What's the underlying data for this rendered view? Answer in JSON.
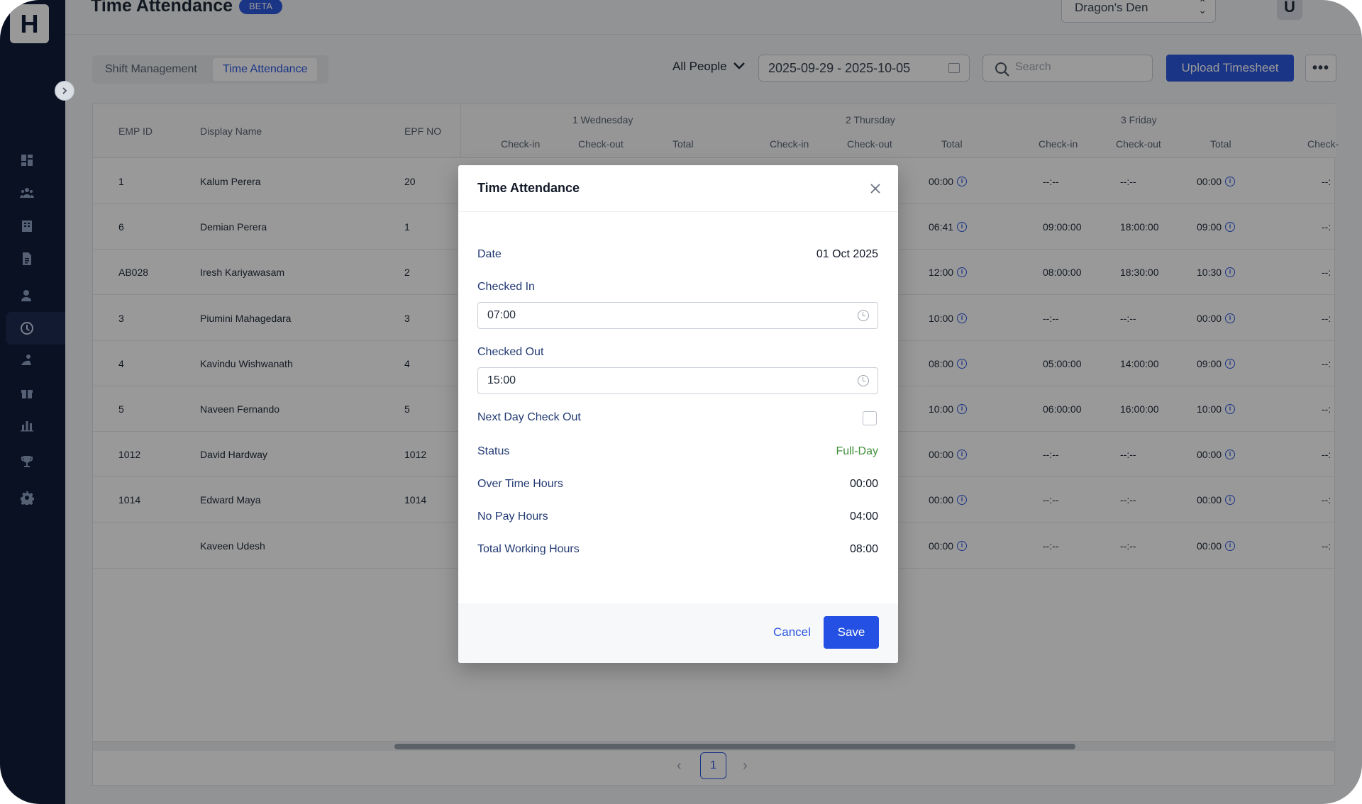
{
  "header": {
    "title": "Time Attendance",
    "badge": "BETA",
    "org": "Dragon's Den",
    "user_initial": "U",
    "logo": "H"
  },
  "toolbar": {
    "tabs": [
      "Shift Management",
      "Time Attendance"
    ],
    "active_tab": "Time Attendance",
    "people_filter": "All People",
    "date_range": "2025-09-29 - 2025-10-05",
    "search_placeholder": "Search",
    "upload_label": "Upload Timesheet"
  },
  "sidebar": {
    "icons": [
      "dashboard-icon",
      "people-icon",
      "building-icon",
      "document-icon",
      "user-icon",
      "clock-icon",
      "leave-icon",
      "gift-icon",
      "reports-icon",
      "trophy-icon",
      "settings-icon"
    ],
    "active": "clock-icon"
  },
  "table": {
    "columns": [
      "EMP ID",
      "Display Name",
      "EPF NO"
    ],
    "days": [
      "1 Wednesday",
      "2 Thursday",
      "3 Friday"
    ],
    "sub_columns": [
      "Check-in",
      "Check-out",
      "Total"
    ],
    "cut_off_column": "Check-",
    "rows": [
      {
        "emp_id": "1",
        "name": "Kalum Perera",
        "epf": "20",
        "day2_total": "00:00",
        "day3_in": "--:--",
        "day3_out": "--:--",
        "day3_total": "00:00",
        "next": "--:"
      },
      {
        "emp_id": "6",
        "name": "Demian Perera",
        "epf": "1",
        "day2_total": "06:41",
        "day3_in": "09:00:00",
        "day3_out": "18:00:00",
        "day3_total": "09:00",
        "next": "--:"
      },
      {
        "emp_id": "AB028",
        "name": "Iresh Kariyawasam",
        "epf": "2",
        "day2_total": "12:00",
        "day3_in": "08:00:00",
        "day3_out": "18:30:00",
        "day3_total": "10:30",
        "next": "--:"
      },
      {
        "emp_id": "3",
        "name": "Piumini Mahagedara",
        "epf": "3",
        "day2_total": "10:00",
        "day3_in": "--:--",
        "day3_out": "--:--",
        "day3_total": "00:00",
        "next": "--:"
      },
      {
        "emp_id": "4",
        "name": "Kavindu Wishwanath",
        "epf": "4",
        "day2_total": "08:00",
        "day3_in": "05:00:00",
        "day3_out": "14:00:00",
        "day3_total": "09:00",
        "next": "--:"
      },
      {
        "emp_id": "5",
        "name": "Naveen Fernando",
        "epf": "5",
        "day2_total": "10:00",
        "day3_in": "06:00:00",
        "day3_out": "16:00:00",
        "day3_total": "10:00",
        "next": "--:"
      },
      {
        "emp_id": "1012",
        "name": "David Hardway",
        "epf": "1012",
        "day2_total": "00:00",
        "day3_in": "--:--",
        "day3_out": "--:--",
        "day3_total": "00:00",
        "next": "--:"
      },
      {
        "emp_id": "1014",
        "name": "Edward Maya",
        "epf": "1014",
        "day2_total": "00:00",
        "day3_in": "--:--",
        "day3_out": "--:--",
        "day3_total": "00:00",
        "next": "--:"
      },
      {
        "emp_id": "",
        "name": "Kaveen Udesh",
        "epf": "",
        "day2_total": "00:00",
        "day3_in": "--:--",
        "day3_out": "--:--",
        "day3_total": "00:00",
        "next": "--:"
      }
    ]
  },
  "pagination": {
    "current": "1",
    "prev": "‹",
    "next": "›"
  },
  "modal": {
    "title": "Time Attendance",
    "date_label": "Date",
    "date_value": "01 Oct 2025",
    "checked_in_label": "Checked In",
    "checked_in_value": "07:00",
    "checked_out_label": "Checked Out",
    "checked_out_value": "15:00",
    "next_day_label": "Next Day Check Out",
    "next_day_checked": false,
    "status_label": "Status",
    "status_value": "Full-Day",
    "status_color": "#3f8f3a",
    "overtime_label": "Over Time Hours",
    "overtime_value": "00:00",
    "nopay_label": "No Pay Hours",
    "nopay_value": "04:00",
    "total_label": "Total Working Hours",
    "total_value": "08:00",
    "cancel_label": "Cancel",
    "save_label": "Save"
  },
  "colors": {
    "accent": "#2c58e0",
    "sidebar": "#0f1d3b"
  }
}
